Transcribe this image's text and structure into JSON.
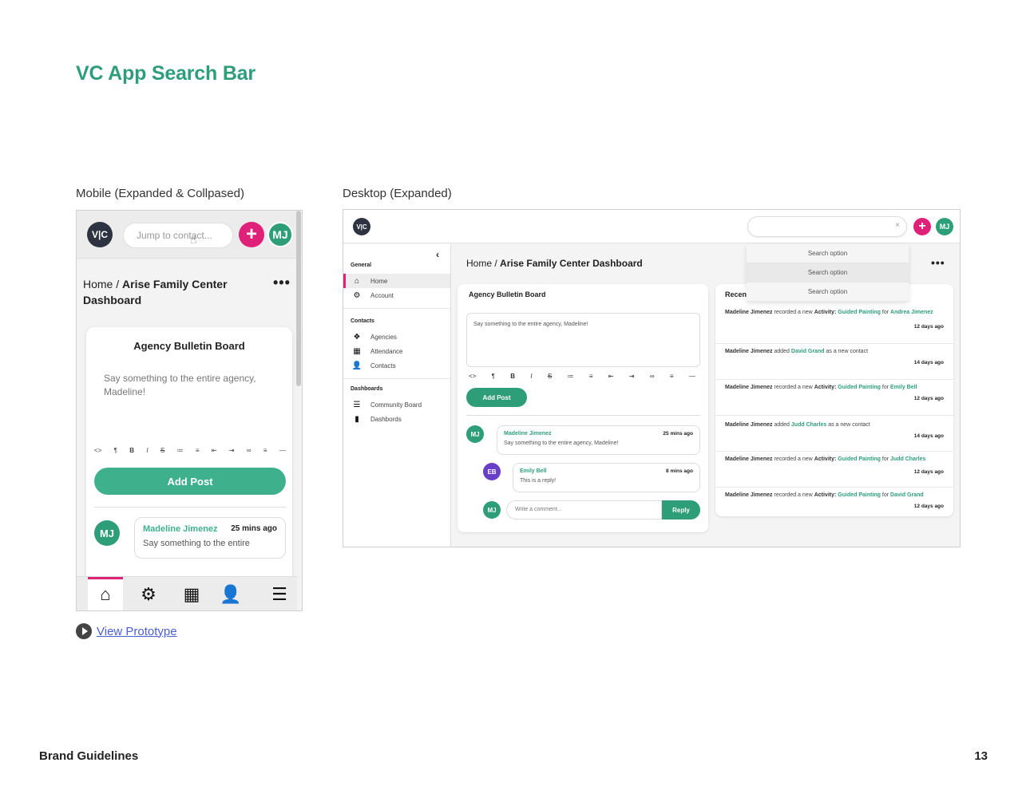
{
  "title": "VC App Search Bar",
  "mobile_label": "Mobile (Expanded & Collpased)",
  "desktop_label": "Desktop (Expanded)",
  "footer": {
    "left": "Brand Guidelines",
    "page_number": "13"
  },
  "view_prototype": "View Prototype",
  "colors": {
    "brand_green": "#2e9e78",
    "accent_pink": "#e0217a",
    "logo_dark": "#2d3340",
    "avatar_purple": "#6a3fc8"
  },
  "mobile": {
    "logo": "V|C",
    "search_placeholder": "Jump to contact...",
    "plus": "+",
    "avatar": "MJ",
    "breadcrumb_home": "Home /",
    "breadcrumb_page": "Arise Family Center Dashboard",
    "more": "•••",
    "board_title": "Agency Bulletin Board",
    "textarea_placeholder": "Say something to the entire agency, Madeline!",
    "toolbar": [
      "<>",
      "¶",
      "B",
      "I",
      "S",
      "≔",
      "≡",
      "⇤",
      "⇥",
      "∞",
      "≡",
      "—"
    ],
    "add_post": "Add Post",
    "post": {
      "avatar": "MJ",
      "name": "Madeline Jimenez",
      "time": "25 mins ago",
      "text": "Say something to the entire"
    },
    "tabbar": [
      {
        "icon": "home-icon",
        "glyph": "⌂"
      },
      {
        "icon": "gears-icon",
        "glyph": "⚙"
      },
      {
        "icon": "calendar-icon",
        "glyph": "▦"
      },
      {
        "icon": "person-icon",
        "glyph": "👤"
      },
      {
        "icon": "menu-icon",
        "glyph": "☰"
      }
    ]
  },
  "desktop": {
    "logo": "V|C",
    "clear": "×",
    "plus": "+",
    "avatar": "MJ",
    "search_options": [
      "Search option",
      "Search option",
      "Search option"
    ],
    "collapse": "‹",
    "sidebar": {
      "general_label": "General",
      "general": [
        {
          "label": "Home",
          "icon": "home-icon",
          "glyph": "⌂"
        },
        {
          "label": "Account",
          "icon": "gears-icon",
          "glyph": "⚙"
        }
      ],
      "contacts_label": "Contacts",
      "contacts": [
        {
          "label": "Agencies",
          "icon": "agencies-icon",
          "glyph": "❖"
        },
        {
          "label": "Attendance",
          "icon": "calendar-icon",
          "glyph": "▦"
        },
        {
          "label": "Contacts",
          "icon": "person-icon",
          "glyph": "👤"
        }
      ],
      "dashboards_label": "Dashboards",
      "dashboards": [
        {
          "label": "Community Board",
          "icon": "list-icon",
          "glyph": "☰"
        },
        {
          "label": "Dashbords",
          "icon": "bar-chart-icon",
          "glyph": "▮"
        }
      ]
    },
    "breadcrumb_home": "Home /",
    "breadcrumb_page": "Arise Family Center Dashboard",
    "more": "•••",
    "board_title": "Agency Bulletin Board",
    "textarea_placeholder": "Say something to the entire agency, Madeline!",
    "toolbar": [
      "<>",
      "¶",
      "B",
      "I",
      "S",
      "≔",
      "≡",
      "⇤",
      "⇥",
      "∞",
      "≡",
      "—"
    ],
    "add_post": "Add Post",
    "post": {
      "avatar": "MJ",
      "name": "Madeline Jimenez",
      "time": "25 mins ago",
      "text": "Say something to the entire agency, Madeline!"
    },
    "reply_post": {
      "avatar": "EB",
      "name": "Emily Bell",
      "time": "8 mins ago",
      "text": "This is a reply!"
    },
    "comment_avatar": "MJ",
    "comment_placeholder": "Write a comment...",
    "reply_button": "Reply",
    "recent_title": "Recen",
    "recent": [
      {
        "actor": "Madeline Jimenez",
        "verb": "recorded a new",
        "kind": "Activity:",
        "activity": "Guided Painting",
        "for": "for",
        "target": "Andrea Jimenez",
        "time": "12 days ago"
      },
      {
        "actor": "Madeline Jimenez",
        "verb": "added",
        "target": "David Grand",
        "tail": "as a new contact",
        "time": "14 days ago"
      },
      {
        "actor": "Madeline Jimenez",
        "verb": "recorded a new",
        "kind": "Activity:",
        "activity": "Guided Painting",
        "for": "for",
        "target": "Emily Bell",
        "time": "12 days ago"
      },
      {
        "actor": "Madeline Jimenez",
        "verb": "added",
        "target": "Judd Charles",
        "tail": "as a new contact",
        "time": "14 days ago"
      },
      {
        "actor": "Madeline Jimenez",
        "verb": "recorded a new",
        "kind": "Activity:",
        "activity": "Guided Painting",
        "for": "for",
        "target": "Judd Charles",
        "time": "12 days ago"
      },
      {
        "actor": "Madeline Jimenez",
        "verb": "recorded a new",
        "kind": "Activity:",
        "activity": "Guided Painting",
        "for": "for",
        "target": "David Grand",
        "time": "12 days ago"
      }
    ]
  }
}
